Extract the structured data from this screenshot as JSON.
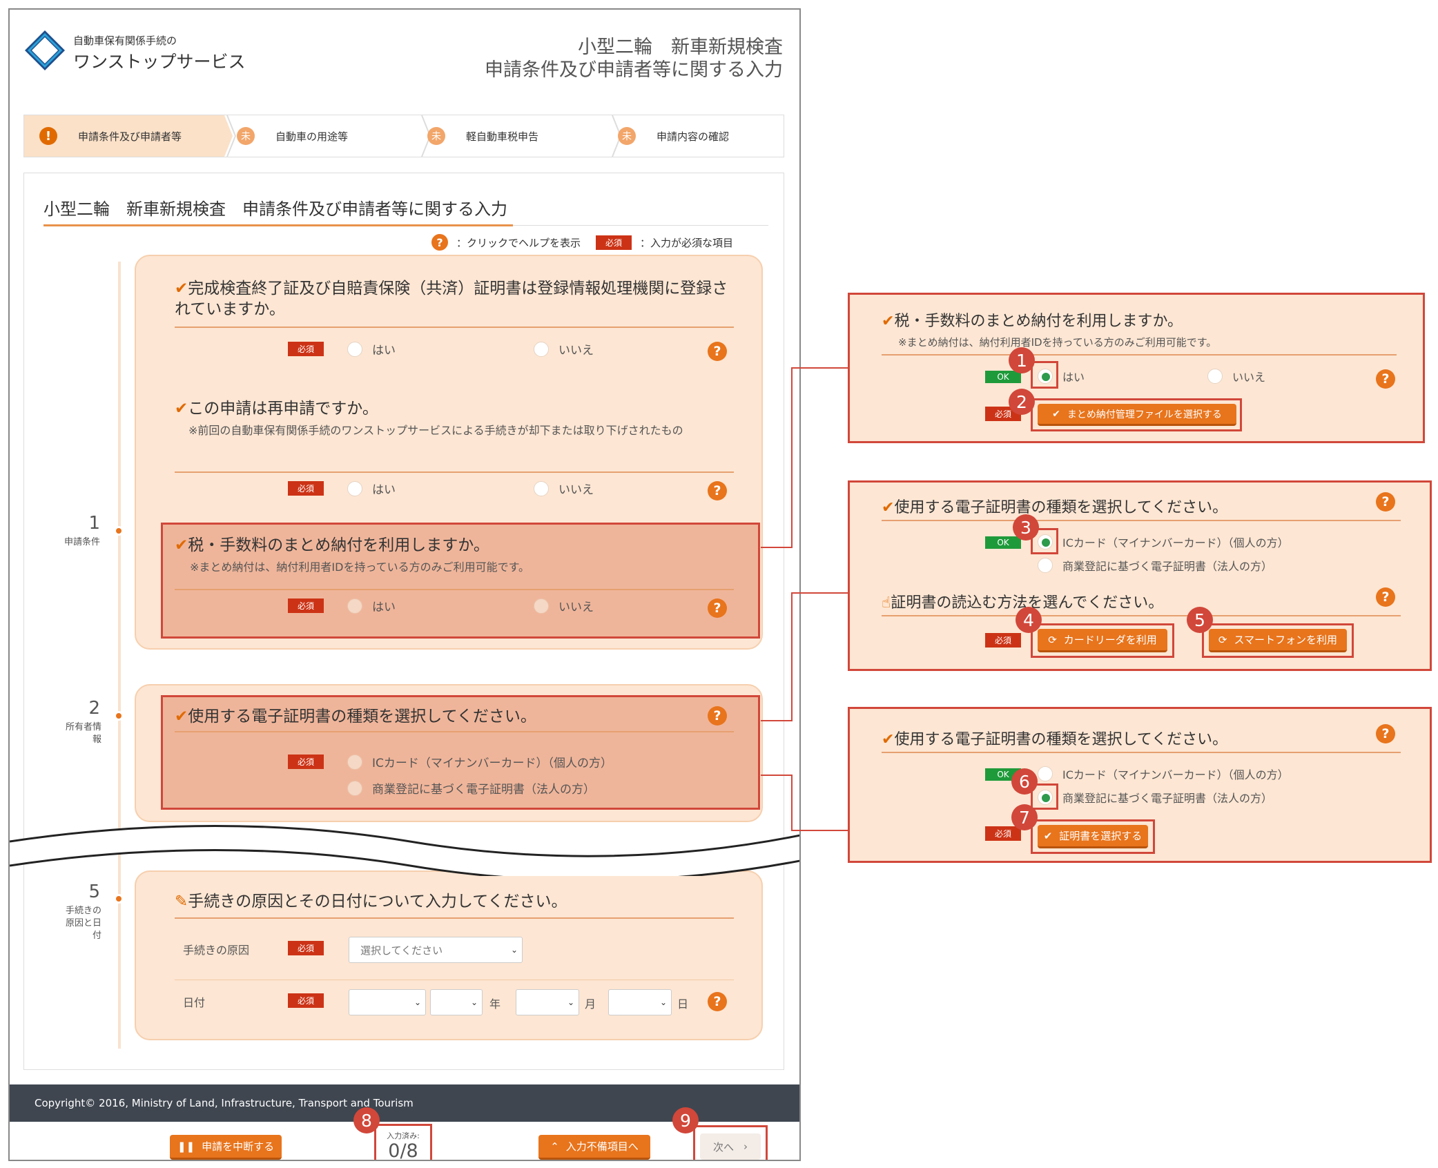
{
  "header": {
    "logo_small": "自動車保有関係手続の",
    "logo_big": "ワンストップサービス",
    "title_line1": "小型二輪　新車新規検査",
    "title_line2": "申請条件及び申請者等に関する入力"
  },
  "stepper": [
    {
      "icon": "!",
      "label": "申請条件及び申請者等"
    },
    {
      "icon": "未",
      "label": "自動車の用途等"
    },
    {
      "icon": "未",
      "label": "軽自動車税申告"
    },
    {
      "icon": "未",
      "label": "申請内容の確認"
    }
  ],
  "page": {
    "title": "小型二輪　新車新規検査　申請条件及び申請者等に関する入力",
    "legend_help": "：クリックでヘルプを表示",
    "legend_required": "：入力が必須な項目",
    "help_glyph": "?",
    "required_tag": "必須",
    "ok_tag": "OK"
  },
  "sections": {
    "s1": {
      "num": "1",
      "label": "申請条件"
    },
    "s2": {
      "num": "2",
      "label": "所有者情報"
    },
    "s5": {
      "num": "5",
      "label": "手続きの原因と日付"
    }
  },
  "questions": {
    "q1": {
      "title": "完成検査終了証及び自賠責保険（共済）証明書は登録情報処理機関に登録されていますか。",
      "yes": "はい",
      "no": "いいえ"
    },
    "q2": {
      "title": "この申請は再申請ですか。",
      "note": "※前回の自動車保有関係手続のワンストップサービスによる手続きが却下または取り下げされたもの",
      "yes": "はい",
      "no": "いいえ"
    },
    "q3": {
      "title": "税・手数料のまとめ納付を利用しますか。",
      "note": "※まとめ納付は、納付利用者IDを持っている方のみご利用可能です。",
      "yes": "はい",
      "no": "いいえ"
    },
    "q4": {
      "title": "使用する電子証明書の種類を選択してください。",
      "opt1": "ICカード（マイナンバーカード）（個人の方）",
      "opt2": "商業登記に基づく電子証明書（法人の方）"
    },
    "q5": {
      "title": "手続きの原因とその日付について入力してください。",
      "cause_label": "手続きの原因",
      "cause_placeholder": "選択してください",
      "date_label": "日付",
      "year": "年",
      "month": "月",
      "day": "日"
    }
  },
  "footer": {
    "copyright": "Copyright© 2016, Ministry of Land, Infrastructure, Transport and Tourism",
    "suspend_btn": "申請を中断する",
    "counter_label": "入力済み:",
    "counter_value": "0/8",
    "missing_btn": "入力不備項目へ",
    "next_btn": "次へ"
  },
  "zoom": {
    "z1": {
      "title": "税・手数料のまとめ納付を利用しますか。",
      "note": "※まとめ納付は、納付利用者IDを持っている方のみご利用可能です。",
      "yes": "はい",
      "no": "いいえ",
      "file_btn": "まとめ納付管理ファイルを選択する"
    },
    "z2": {
      "title": "使用する電子証明書の種類を選択してください。",
      "opt1": "ICカード（マイナンバーカード）（個人の方）",
      "opt2": "商業登記に基づく電子証明書（法人の方）",
      "read_title": "証明書の読込む方法を選んでください。",
      "card_btn": "カードリーダを利用",
      "phone_btn": "スマートフォンを利用"
    },
    "z3": {
      "title": "使用する電子証明書の種類を選択してください。",
      "opt1": "ICカード（マイナンバーカード）（個人の方）",
      "opt2": "商業登記に基づく電子証明書（法人の方）",
      "cert_btn": "証明書を選択する"
    }
  },
  "badges": [
    "1",
    "2",
    "3",
    "4",
    "5",
    "6",
    "7",
    "8",
    "9"
  ],
  "colors": {
    "accent": "#e8741c",
    "highlight_border": "#d1473a",
    "panel": "#fde6d3",
    "required": "#cc3316",
    "ok": "#1f9a3a",
    "footer": "#3f4650"
  }
}
